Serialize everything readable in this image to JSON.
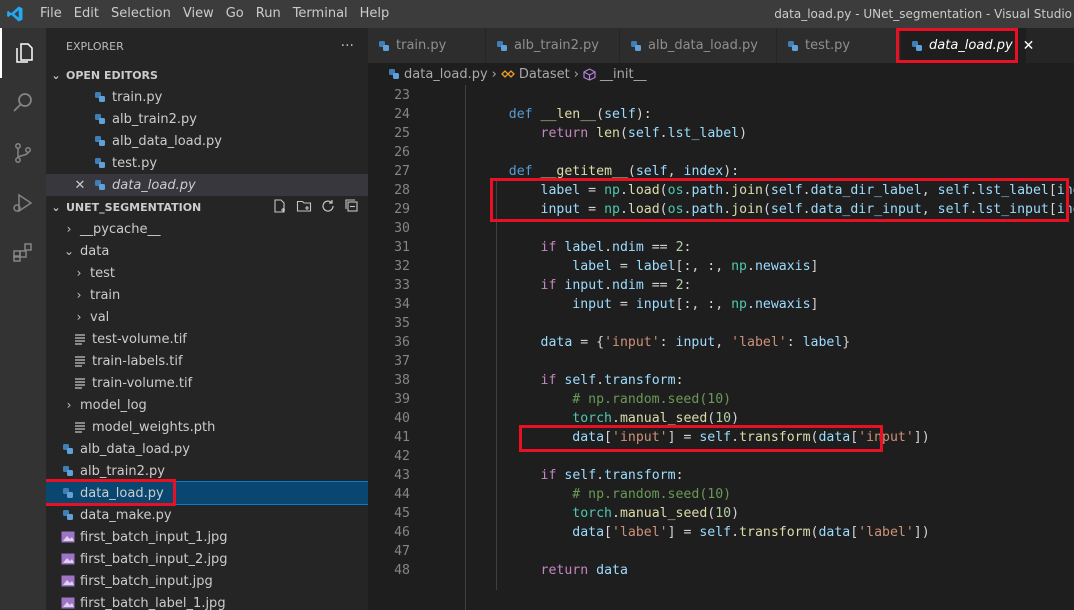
{
  "window": {
    "title": "data_load.py - UNet_segmentation - Visual Studio"
  },
  "menu": [
    "File",
    "Edit",
    "Selection",
    "View",
    "Go",
    "Run",
    "Terminal",
    "Help"
  ],
  "sidebar": {
    "header": "EXPLORER",
    "more_label": "···",
    "open_editors": {
      "title": "OPEN EDITORS",
      "items": [
        "train.py",
        "alb_train2.py",
        "alb_data_load.py",
        "test.py",
        "data_load.py"
      ]
    },
    "project": {
      "title": "UNET_SEGMENTATION",
      "items": [
        {
          "label": "__pycache__",
          "type": "folder",
          "open": false
        },
        {
          "label": "data",
          "type": "folder",
          "open": true
        },
        {
          "label": "test",
          "type": "folder",
          "open": false
        },
        {
          "label": "train",
          "type": "folder",
          "open": false
        },
        {
          "label": "val",
          "type": "folder",
          "open": false
        },
        {
          "label": "test-volume.tif",
          "type": "file"
        },
        {
          "label": "train-labels.tif",
          "type": "file"
        },
        {
          "label": "train-volume.tif",
          "type": "file"
        },
        {
          "label": "model_log",
          "type": "folder",
          "open": false
        },
        {
          "label": "model_weights.pth",
          "type": "file"
        },
        {
          "label": "alb_data_load.py",
          "type": "py"
        },
        {
          "label": "alb_train2.py",
          "type": "py"
        },
        {
          "label": "data_load.py",
          "type": "py"
        },
        {
          "label": "data_make.py",
          "type": "py"
        },
        {
          "label": "first_batch_input_1.jpg",
          "type": "img"
        },
        {
          "label": "first_batch_input_2.jpg",
          "type": "img"
        },
        {
          "label": "first_batch_input.jpg",
          "type": "img"
        },
        {
          "label": "first_batch_label_1.jpg",
          "type": "img"
        }
      ]
    }
  },
  "tabs": [
    "train.py",
    "alb_train2.py",
    "alb_data_load.py",
    "test.py",
    "data_load.py"
  ],
  "breadcrumb": {
    "file": "data_load.py",
    "class": "Dataset",
    "method": "__init__"
  },
  "code": {
    "line_numbers": [
      "23",
      "24",
      "25",
      "26",
      "27",
      "28",
      "29",
      "30",
      "31",
      "32",
      "33",
      "34",
      "35",
      "36",
      "37",
      "38",
      "39",
      "40",
      "41",
      "42",
      "43",
      "44",
      "45",
      "46",
      "47",
      "48"
    ]
  },
  "colors": {
    "highlight": "#e81123",
    "accent": "#007acc"
  }
}
